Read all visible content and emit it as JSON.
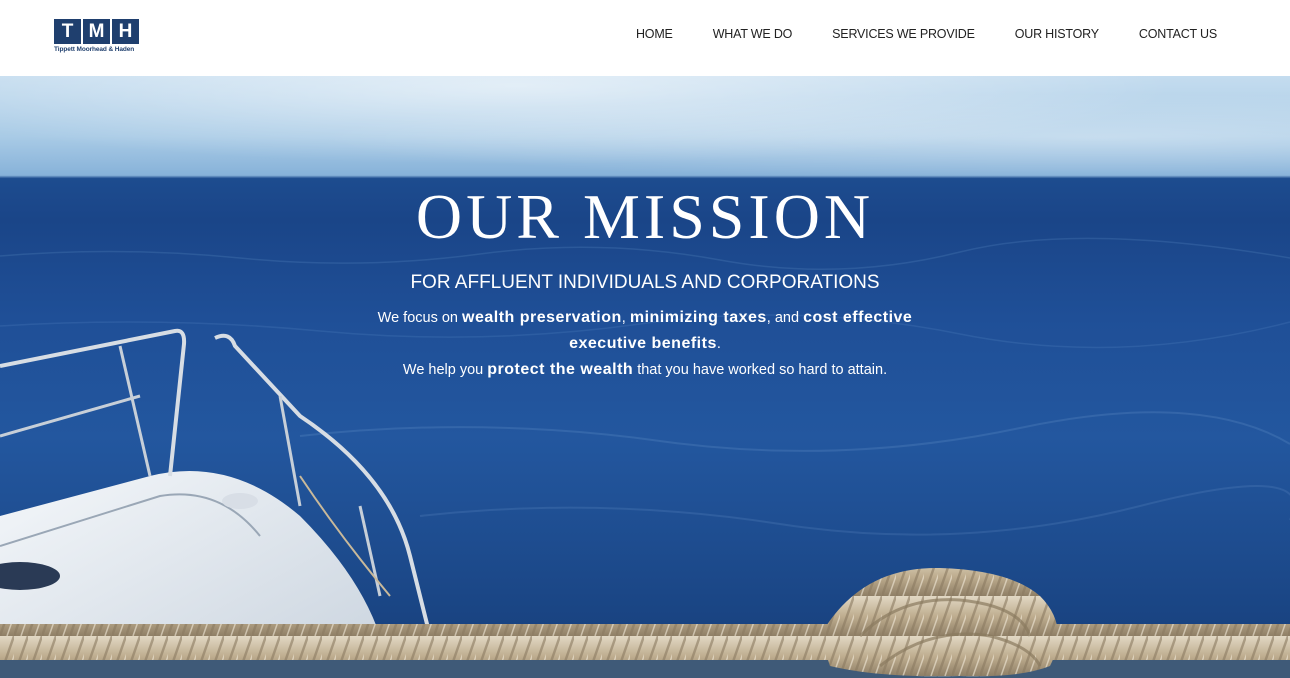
{
  "header": {
    "logo": {
      "letters": [
        "T",
        "M",
        "H"
      ],
      "tagline": "Tippett Moorhead & Haden"
    },
    "nav": [
      {
        "label": "HOME"
      },
      {
        "label": "WHAT WE DO"
      },
      {
        "label": "SERVICES WE PROVIDE"
      },
      {
        "label": "OUR HISTORY"
      },
      {
        "label": "CONTACT US"
      }
    ]
  },
  "hero": {
    "title": "OUR MISSION",
    "subtitle": "FOR AFFLUENT INDIVIDUALS AND CORPORATIONS",
    "line1": {
      "t1": "We focus on ",
      "b1": "wealth preservation",
      "t2": ", ",
      "b2": "minimizing taxes",
      "t3": ", and ",
      "b3": "cost effective executive benefits",
      "t4": "."
    },
    "line2": {
      "t1": "We help you ",
      "b1": "protect the wealth",
      "t2": " that you have worked so hard to attain."
    }
  },
  "colors": {
    "brand": "#1f3f6e",
    "sea": "#1f4f97",
    "sky": "#a9cbe6"
  }
}
